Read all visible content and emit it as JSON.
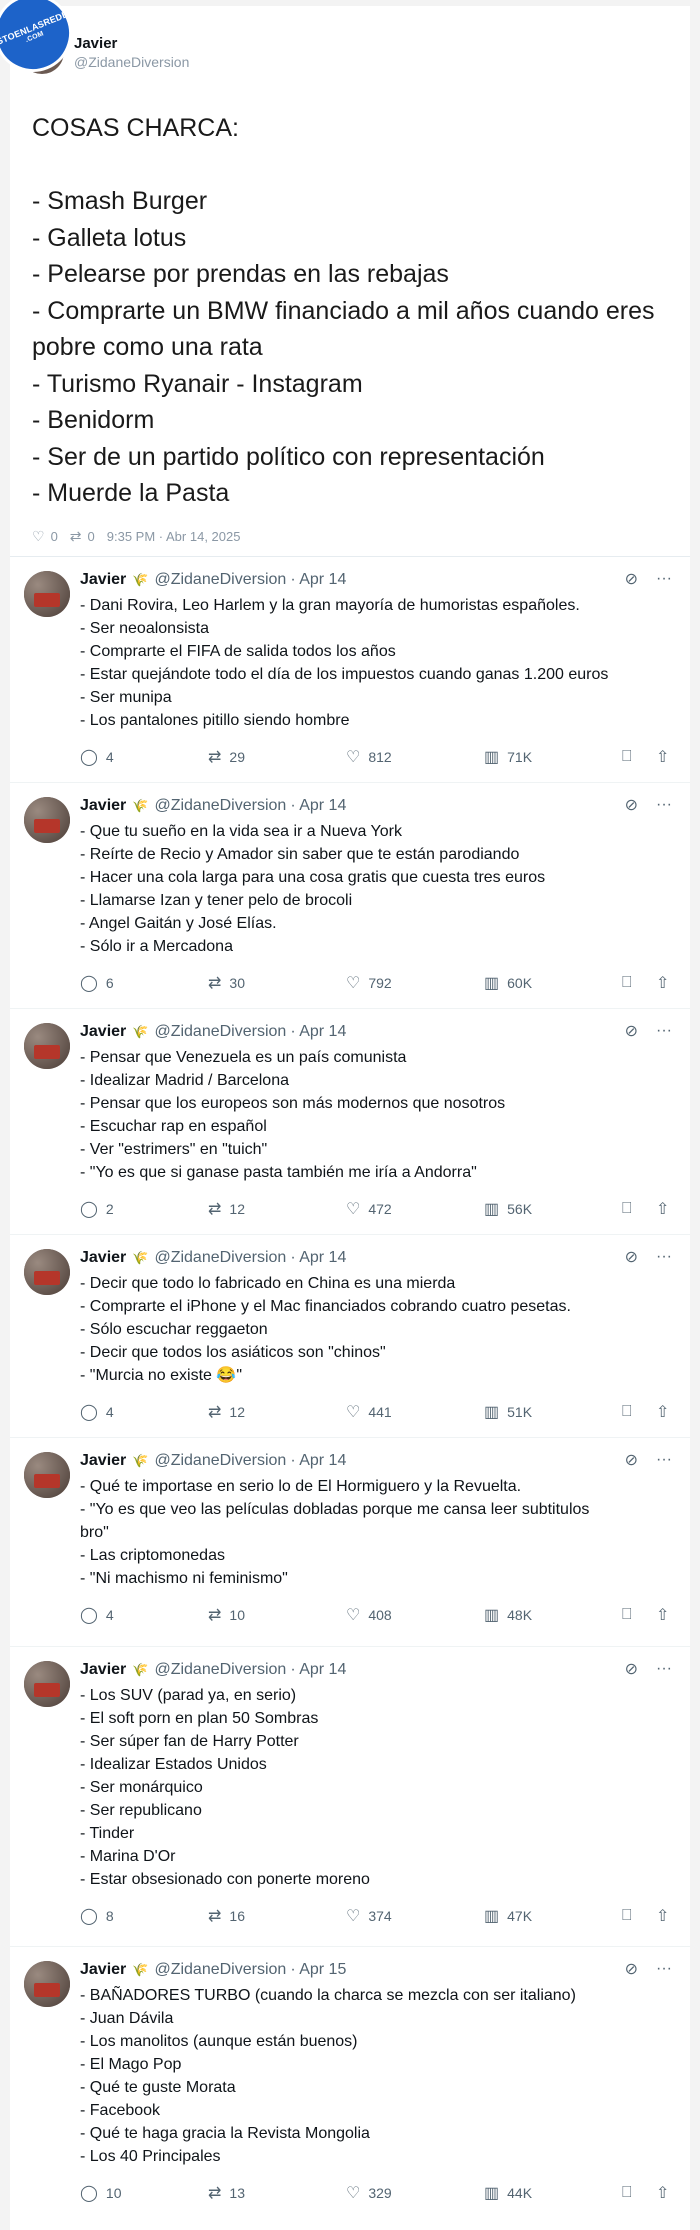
{
  "watermark": {
    "line1": "VISTOENLASREDES",
    "line2": ".COM"
  },
  "op": {
    "name": "Javier",
    "handle": "@ZidaneDiversion",
    "lines": [
      "COSAS CHARCA:",
      "",
      "- Smash Burger",
      "- Galleta lotus",
      "- Pelearse por prendas en las rebajas",
      "- Comprarte un BMW financiado a mil años cuando eres",
      "pobre como una rata",
      "- Turismo Ryanair - Instagram",
      "- Benidorm",
      "- Ser de un partido político con representación",
      "- Muerde la Pasta"
    ],
    "likes": "0",
    "retweets": "0",
    "timestamp": "9:35 PM · Abr 14, 2025"
  },
  "replies": [
    {
      "name": "Javier",
      "handle": "@ZidaneDiversion",
      "date": "· Apr 14",
      "lines": [
        "- Dani Rovira, Leo Harlem y la gran mayoría de humoristas españoles.",
        "- Ser neoalonsista",
        "- Comprarte el FIFA de salida todos los años",
        "- Estar quejándote todo el día de los impuestos cuando ganas 1.200 euros",
        "- Ser munipa",
        "- Los pantalones pitillo siendo hombre"
      ],
      "replies": "4",
      "retweets": "29",
      "likes": "812",
      "views": "71K"
    },
    {
      "name": "Javier",
      "handle": "@ZidaneDiversion",
      "date": "· Apr 14",
      "lines": [
        "- Que tu sueño en la vida sea ir a Nueva York",
        "- Reírte de Recio y Amador sin saber que te están parodiando",
        "- Hacer una cola larga para una cosa gratis que cuesta tres euros",
        "- Llamarse Izan y tener pelo de brocoli",
        "- Angel Gaitán y José Elías.",
        "- Sólo ir a Mercadona"
      ],
      "replies": "6",
      "retweets": "30",
      "likes": "792",
      "views": "60K"
    },
    {
      "name": "Javier",
      "handle": "@ZidaneDiversion",
      "date": "· Apr 14",
      "lines": [
        "- Pensar que Venezuela es un país comunista",
        "- Idealizar Madrid / Barcelona",
        "- Pensar que los europeos son más modernos que nosotros",
        "- Escuchar rap en español",
        "- Ver \"estrimers\" en \"tuich\"",
        "- \"Yo es que si ganase pasta también me iría a Andorra\""
      ],
      "replies": "2",
      "retweets": "12",
      "likes": "472",
      "views": "56K"
    },
    {
      "name": "Javier",
      "handle": "@ZidaneDiversion",
      "date": "· Apr 14",
      "lines": [
        "- Decir que todo lo fabricado en China es una mierda",
        "- Comprarte el iPhone y el Mac financiados cobrando cuatro pesetas.",
        "- Sólo escuchar reggaeton",
        "- Decir que todos los asiáticos son \"chinos\"",
        "- \"Murcia no existe 😂\""
      ],
      "replies": "4",
      "retweets": "12",
      "likes": "441",
      "views": "51K"
    },
    {
      "name": "Javier",
      "handle": "@ZidaneDiversion",
      "date": "· Apr 14",
      "lines": [
        "- Qué te importase en serio lo de El Hormiguero y la Revuelta.",
        "- \"Yo es que veo las películas dobladas porque me cansa leer subtitulos",
        "bro\"",
        "- Las criptomonedas",
        "- \"Ni machismo ni feminismo\""
      ],
      "replies": "4",
      "retweets": "10",
      "likes": "408",
      "views": "48K"
    },
    {
      "name": "Javier",
      "handle": "@ZidaneDiversion",
      "date": "· Apr 14",
      "lines": [
        "- Los SUV (parad ya, en serio)",
        "- El soft porn en plan 50 Sombras",
        "- Ser súper fan de Harry Potter",
        "- Idealizar Estados Unidos",
        "- Ser monárquico",
        "- Ser republicano",
        "- Tinder",
        "- Marina D'Or",
        "- Estar obsesionado con ponerte moreno"
      ],
      "replies": "8",
      "retweets": "16",
      "likes": "374",
      "views": "47K"
    },
    {
      "name": "Javier",
      "handle": "@ZidaneDiversion",
      "date": "· Apr 15",
      "lines": [
        "- BAÑADORES TURBO (cuando la charca se mezcla con ser italiano)",
        "- Juan Dávila",
        "- Los manolitos (aunque están buenos)",
        "- El Mago Pop",
        "- Qué te guste Morata",
        "- Facebook",
        "- Qué te haga gracia la Revista Mongolia",
        "- Los 40 Principales"
      ],
      "replies": "10",
      "retweets": "13",
      "likes": "329",
      "views": "44K"
    }
  ],
  "icons": {
    "reply": "reply-icon",
    "retweet": "retweet-icon",
    "like": "heart-icon",
    "views": "views-icon",
    "bookmark": "bookmark-icon",
    "share": "share-icon",
    "grok": "grok-icon",
    "more": "more-icon",
    "verified_plant": "plant-icon"
  },
  "colors": {
    "badge": "#1d63c9",
    "plant": "#6aa84f",
    "muted": "#536471"
  }
}
